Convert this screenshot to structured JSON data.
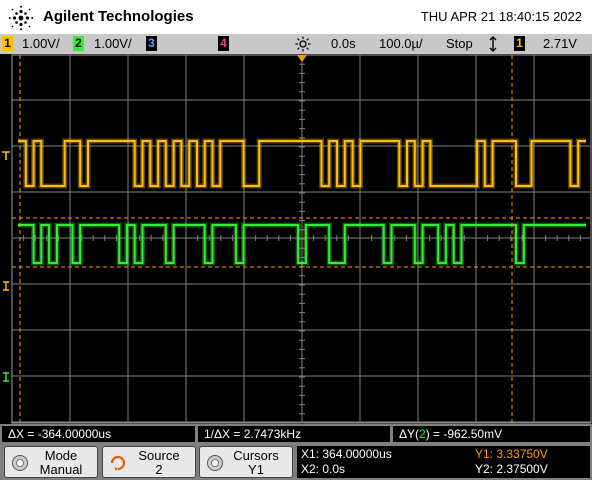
{
  "header": {
    "brand": "Agilent Technologies",
    "datetime": "THU APR 21 18:40:15 2022"
  },
  "status": {
    "ch1": {
      "num": "1",
      "scale": "1.00V/",
      "color": "#ffc000"
    },
    "ch2": {
      "num": "2",
      "scale": "1.00V/",
      "color": "#33ee33"
    },
    "ch3": {
      "num": "3"
    },
    "ch4": {
      "num": "4"
    },
    "trigger_icon": "trigger-sun-icon",
    "delay": "0.0s",
    "timebase": "100.0µ/",
    "run_state": "Stop",
    "slope_icon": "rising-falling-edge-icon",
    "trig_ch": "1",
    "trig_level": "2.71V"
  },
  "readouts": {
    "dx": "ΔX = -364.00000us",
    "inv_dx": "1/ΔX = 2.7473kHz",
    "dy_prefix": "ΔY(",
    "dy_ch": "2",
    "dy_suffix": ") = -962.50mV"
  },
  "softkeys": {
    "mode": {
      "label": "Mode",
      "value": "Manual"
    },
    "source": {
      "label": "Source",
      "value": "2"
    },
    "cursors": {
      "label": "Cursors",
      "value": "Y1"
    }
  },
  "cursor_values": {
    "x1": "X1: 364.00000us",
    "x2": "X2: 0.0s",
    "y1": "Y1: 3.33750V",
    "y2": "Y2: 2.37500V"
  },
  "colors": {
    "ch1": "#ffc000",
    "ch2": "#33ee33",
    "cursor": "#ff9900",
    "grid": "#808080"
  },
  "waveforms": {
    "ch1_bits": "1010001101111110101010101011100111111110101011111010100000010111001111101",
    "ch2_bits": "1101011011111010111011110111011111110111001111101110110101111111011111111"
  }
}
